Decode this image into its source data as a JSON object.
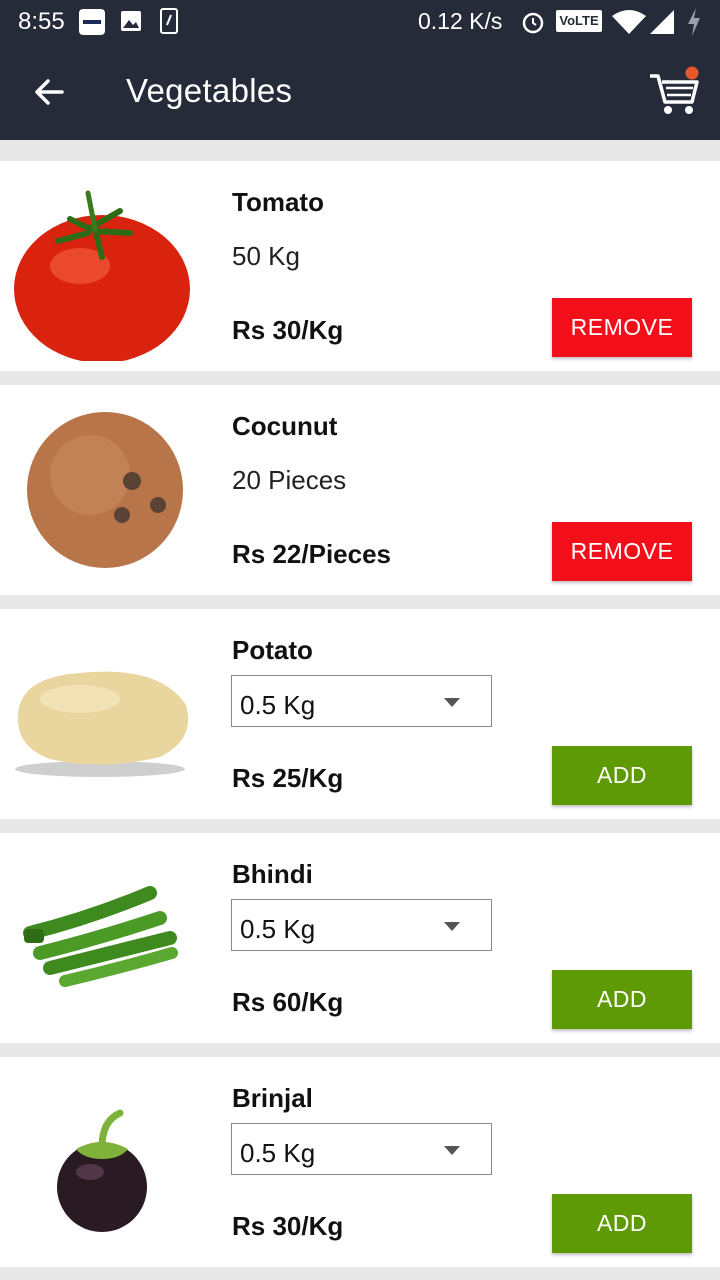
{
  "status_bar": {
    "time": "8:55",
    "network_rate": "0.12 K/s",
    "volte_label": "VoLTE",
    "icons": [
      "paytm-icon",
      "image-icon",
      "phone-icon",
      "alarm-icon",
      "volte-icon",
      "wifi-icon",
      "signal-icon",
      "charging-icon"
    ]
  },
  "app_bar": {
    "title": "Vegetables",
    "back_icon": "arrow-left-icon",
    "cart_icon": "shopping-cart-icon",
    "cart_badge_color": "#e8572a"
  },
  "colors": {
    "app_bar": "#252b38",
    "remove_button": "#f20f1a",
    "add_button": "#5e9a05"
  },
  "products": [
    {
      "name": "Tomato",
      "quantity": "50 Kg",
      "price": "Rs 30/Kg",
      "action": "REMOVE",
      "image": "tomato"
    },
    {
      "name": "Cocunut",
      "quantity": "20 Pieces",
      "price": "Rs 22/Pieces",
      "action": "REMOVE",
      "image": "coconut"
    },
    {
      "name": "Potato",
      "select_value": "0.5 Kg",
      "price": "Rs 25/Kg",
      "action": "ADD",
      "image": "potato"
    },
    {
      "name": "Bhindi",
      "select_value": "0.5 Kg",
      "price": "Rs 60/Kg",
      "action": "ADD",
      "image": "okra"
    },
    {
      "name": "Brinjal",
      "select_value": "0.5 Kg",
      "price": "Rs 30/Kg",
      "action": "ADD",
      "image": "brinjal"
    }
  ]
}
